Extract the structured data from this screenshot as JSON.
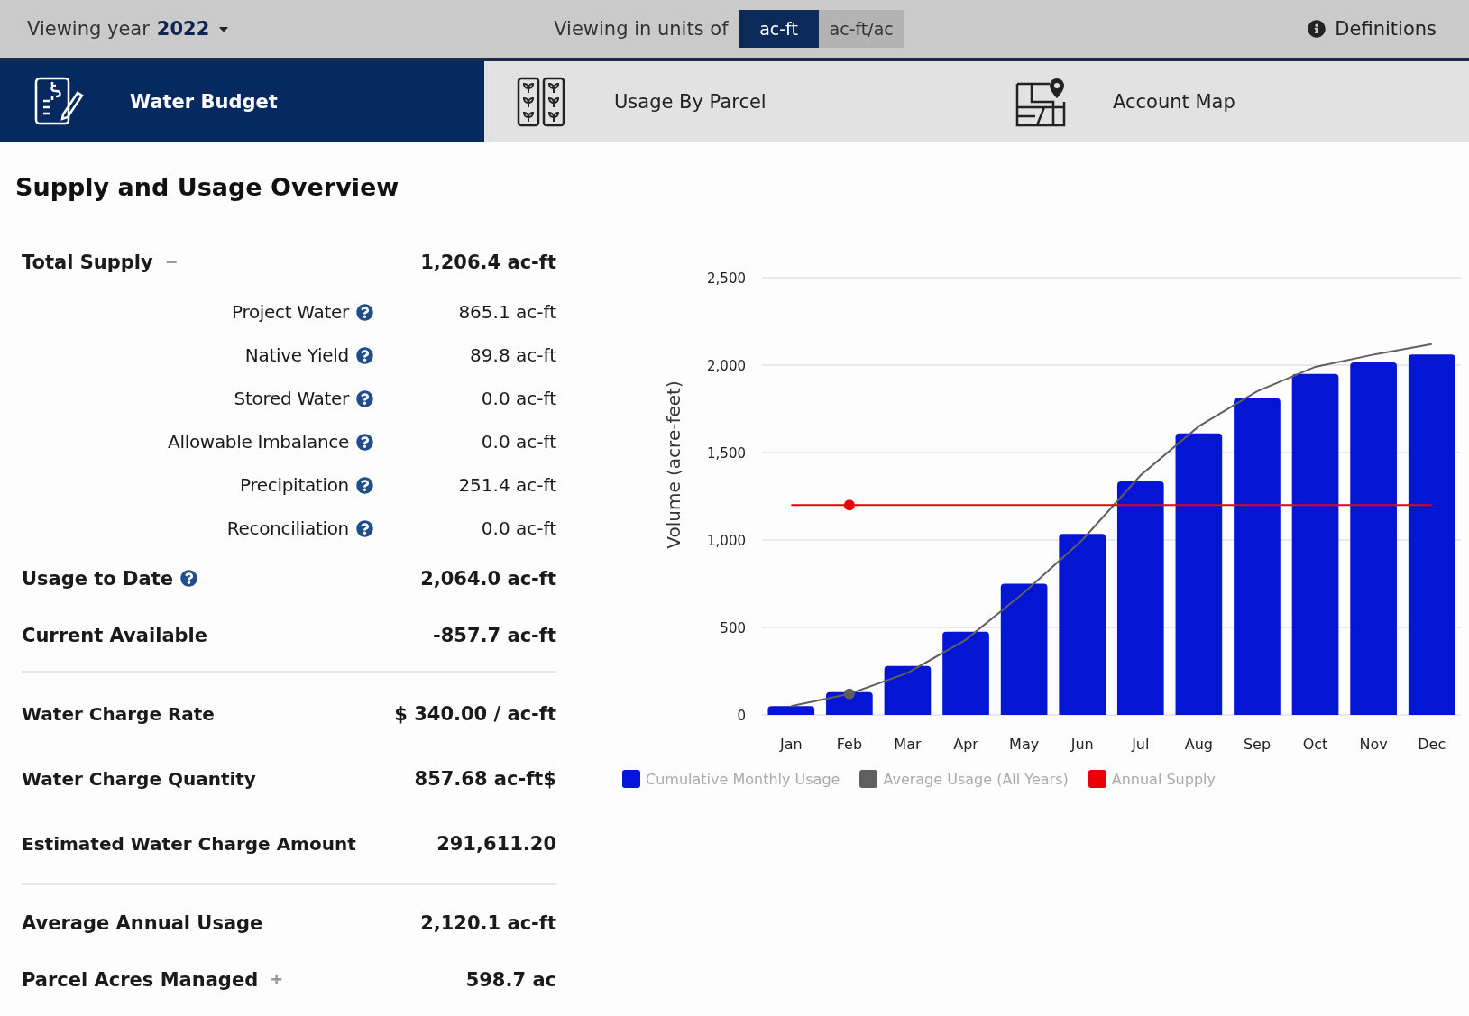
{
  "top_bar": {
    "year_label": "Viewing year",
    "year": "2022",
    "units_label": "Viewing in units of",
    "units": [
      {
        "label": "ac-ft",
        "selected": true
      },
      {
        "label": "ac-ft/ac",
        "selected": false
      }
    ],
    "definitions": "Definitions"
  },
  "tabs": [
    {
      "label": "Water Budget",
      "selected": true
    },
    {
      "label": "Usage By Parcel",
      "selected": false
    },
    {
      "label": "Account Map",
      "selected": false
    }
  ],
  "overview": {
    "title": "Supply and Usage Overview",
    "sections": [
      [
        {
          "kind": "main",
          "label": "Total Supply",
          "toggle": "−",
          "value": "1,206.4 ac-ft"
        },
        {
          "kind": "sub",
          "label": "Project Water",
          "help": true,
          "value": "865.1 ac-ft"
        },
        {
          "kind": "sub",
          "label": "Native Yield",
          "help": true,
          "value": "89.8 ac-ft"
        },
        {
          "kind": "sub",
          "label": "Stored Water",
          "help": true,
          "value": "0.0 ac-ft"
        },
        {
          "kind": "sub",
          "label": "Allowable Imbalance",
          "help": true,
          "value": "0.0 ac-ft"
        },
        {
          "kind": "sub",
          "label": "Precipitation",
          "help": true,
          "value": "251.4 ac-ft"
        },
        {
          "kind": "sub",
          "label": "Reconciliation",
          "help": true,
          "value": "0.0 ac-ft"
        },
        {
          "kind": "main",
          "label": "Usage to Date",
          "help": true,
          "value": "2,064.0 ac-ft"
        },
        {
          "kind": "main",
          "label": "Current Available",
          "value": "-857.7 ac-ft"
        }
      ],
      [
        {
          "kind": "charge",
          "label": "Water Charge Rate",
          "value": "$ 340.00 / ac-ft"
        },
        {
          "kind": "charge",
          "label": "Water Charge Quantity",
          "value": "857.68 ac-ft$"
        },
        {
          "kind": "charge",
          "label": "Estimated Water Charge Amount",
          "value": "291,611.20"
        }
      ],
      [
        {
          "kind": "main",
          "label": "Average Annual Usage",
          "value": "2,120.1 ac-ft"
        },
        {
          "kind": "main",
          "label": "Parcel Acres Managed",
          "toggle": "+",
          "value": "598.7 ac"
        }
      ]
    ]
  },
  "chart_data": {
    "type": "bar",
    "grid": true,
    "legend": "bottom",
    "ylabel": "Volume (acre-feet)",
    "categories": [
      "Jan",
      "Feb",
      "Mar",
      "Apr",
      "May",
      "Jun",
      "Jul",
      "Aug",
      "Sep",
      "Oct",
      "Nov",
      "Dec"
    ],
    "ylim": [
      0,
      2500
    ],
    "yticks": [
      {
        "value": 0,
        "label": "0"
      },
      {
        "value": 500,
        "label": "500"
      },
      {
        "value": 1000,
        "label": "1,000"
      },
      {
        "value": 1500,
        "label": "1,500"
      },
      {
        "value": 2000,
        "label": "2,000"
      },
      {
        "value": 2500,
        "label": "2,500"
      }
    ],
    "series": [
      {
        "name": "Cumulative Monthly Usage",
        "color": "#0515d4",
        "type": "bar",
        "values": [
          50,
          130,
          280,
          475,
          750,
          1035,
          1335,
          1610,
          1810,
          1950,
          2015,
          2060
        ]
      },
      {
        "name": "Average Usage (All Years)",
        "color": "#5f5f5f",
        "type": "line",
        "values": [
          50,
          120,
          240,
          430,
          700,
          1000,
          1370,
          1650,
          1850,
          1990,
          2060,
          2120
        ]
      },
      {
        "name": "Annual Supply",
        "color": "#e8000b",
        "type": "line",
        "values": [
          1200,
          1200,
          1200,
          1200,
          1200,
          1200,
          1200,
          1200,
          1200,
          1200,
          1200,
          1200
        ]
      }
    ]
  }
}
